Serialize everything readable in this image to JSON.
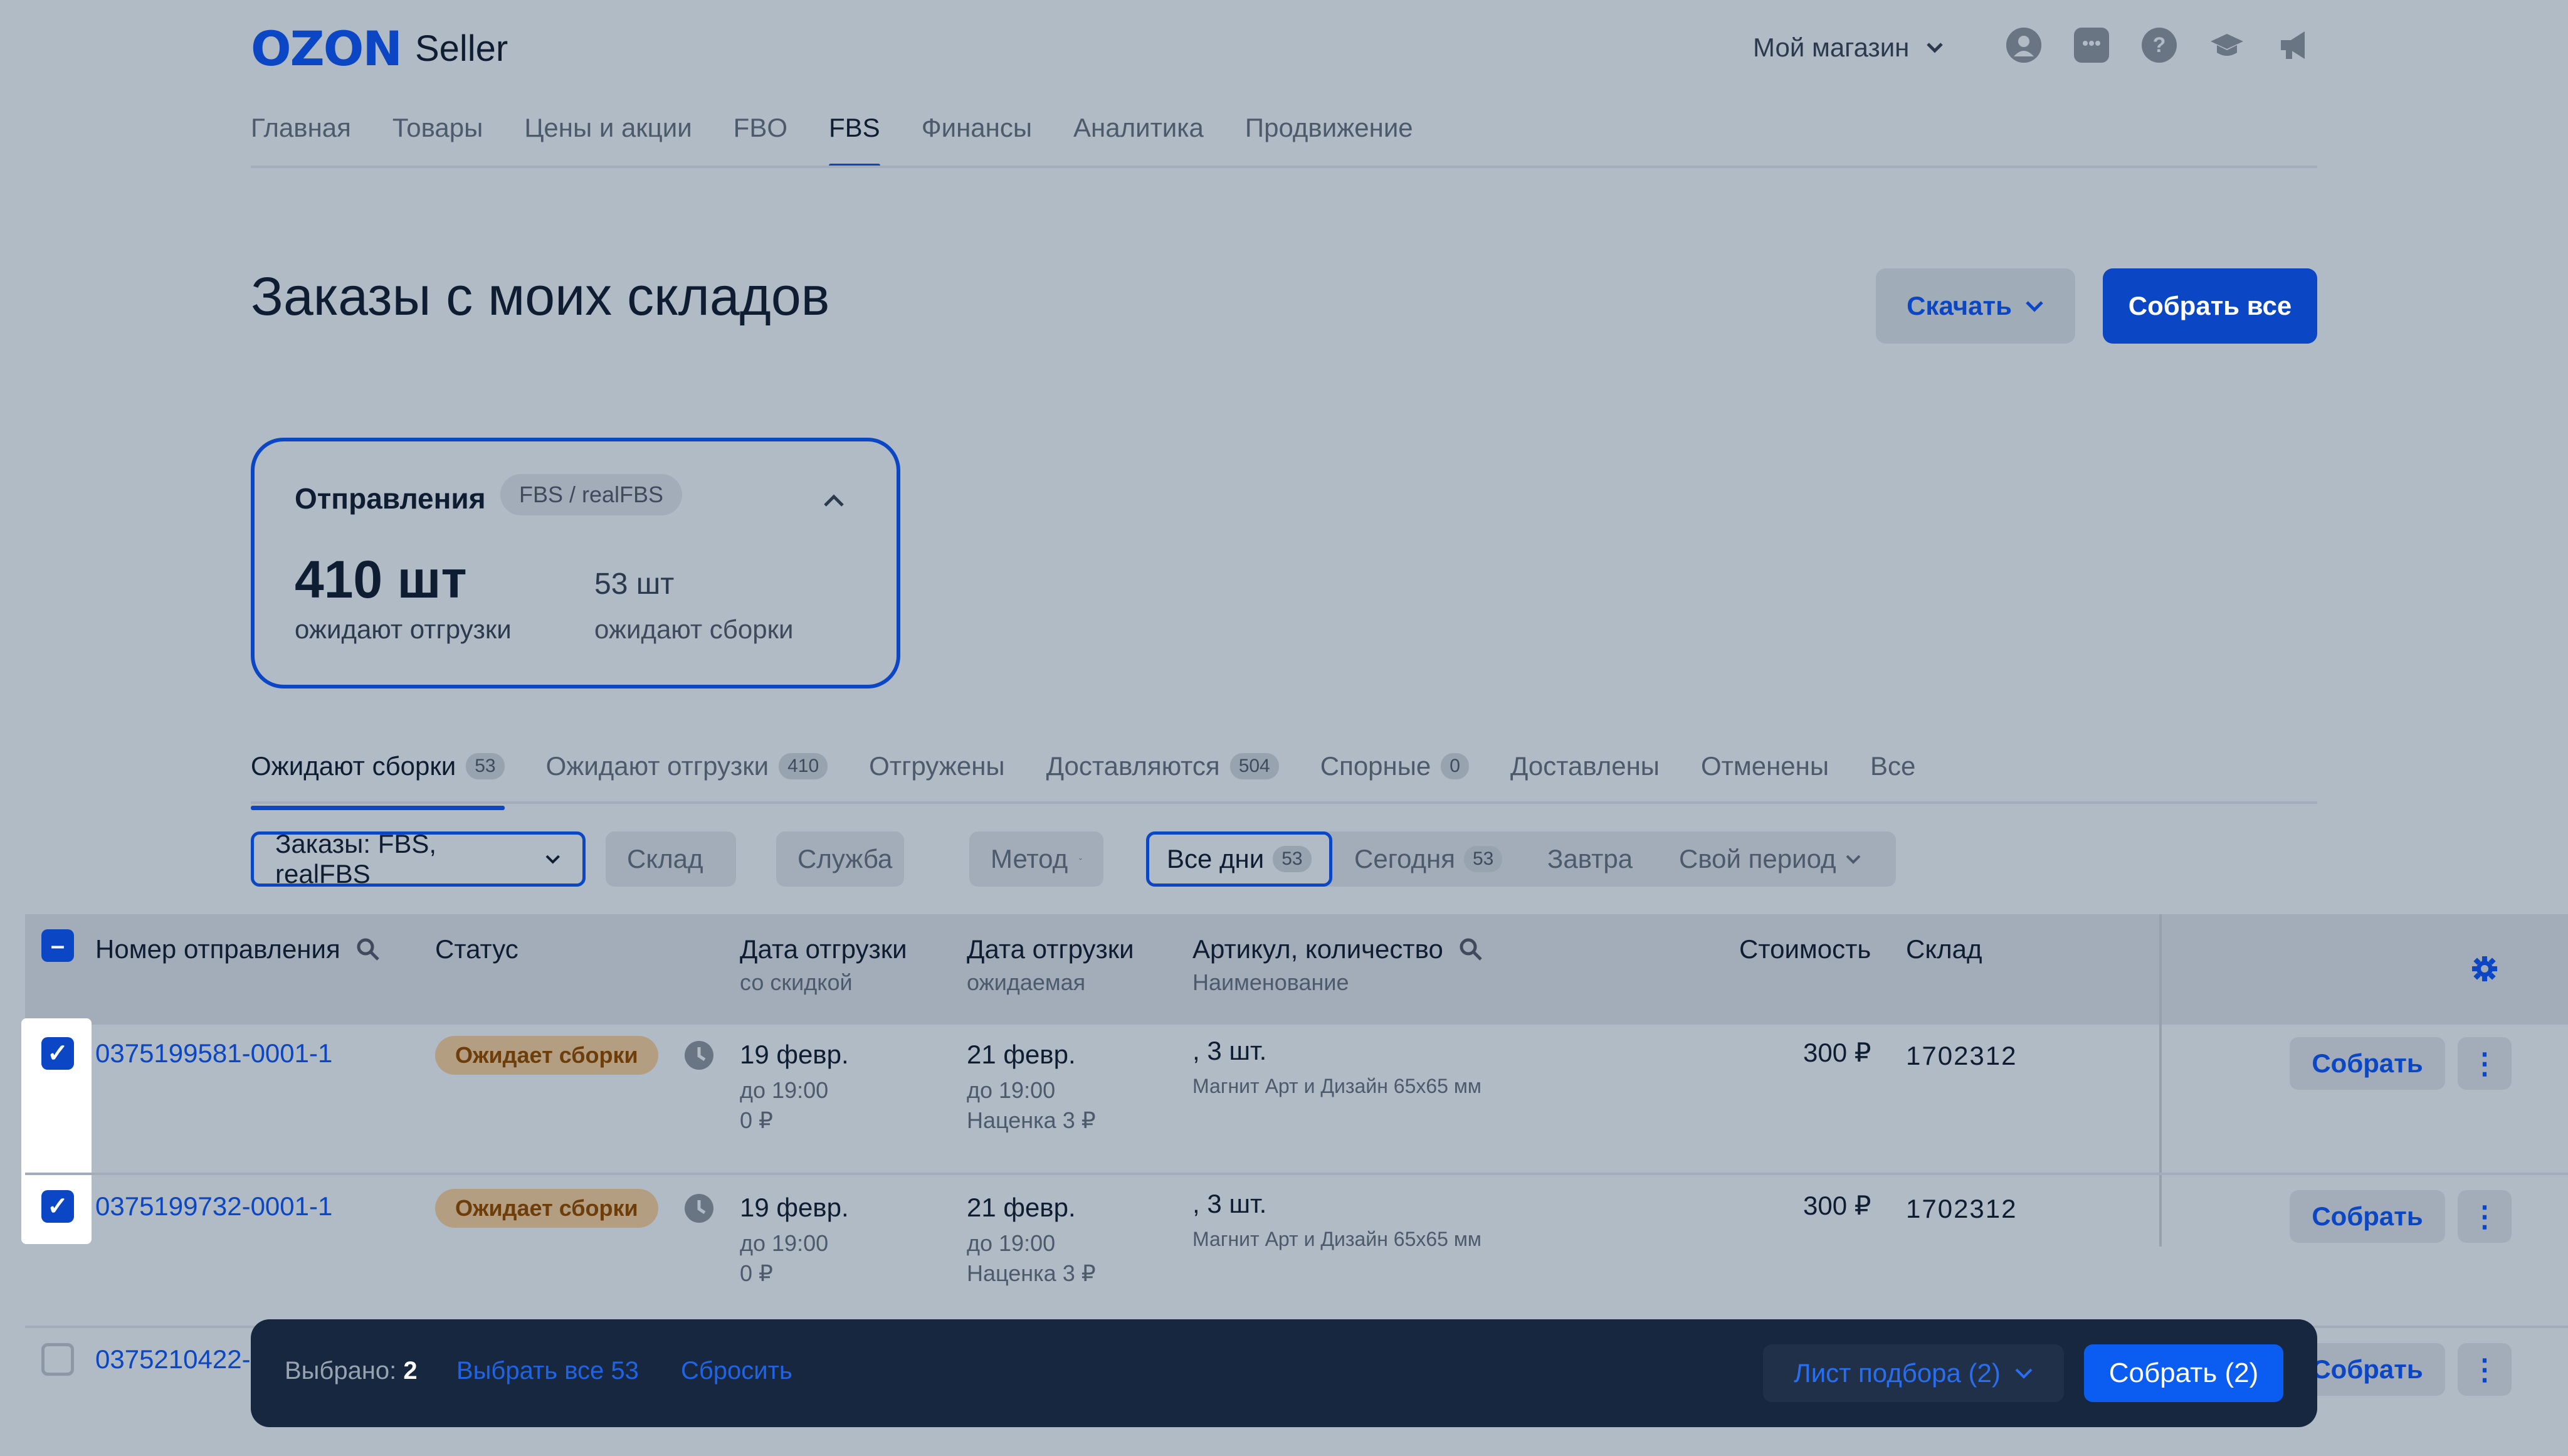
{
  "header": {
    "logo_brand": "OZON",
    "logo_product": "Seller",
    "store_selector": "Мой магазин",
    "icons": [
      "profile-icon",
      "chat-icon",
      "help-icon",
      "education-icon",
      "announcement-icon"
    ]
  },
  "nav": {
    "items": [
      "Главная",
      "Товары",
      "Цены и акции",
      "FBO",
      "FBS",
      "Финансы",
      "Аналитика",
      "Продвижение"
    ],
    "active": "FBS"
  },
  "page": {
    "title": "Заказы с моих складов",
    "download_label": "Скачать",
    "collect_all_label": "Собрать все"
  },
  "summary": {
    "title": "Отправления",
    "badge": "FBS / realFBS",
    "awaiting_shipment_count": "410 шт",
    "awaiting_shipment_label": "ожидают отгрузки",
    "awaiting_assembly_count": "53 шт",
    "awaiting_assembly_label": "ожидают сборки"
  },
  "tabs": [
    {
      "label": "Ожидают сборки",
      "count": "53",
      "active": true
    },
    {
      "label": "Ожидают отгрузки",
      "count": "410"
    },
    {
      "label": "Отгружены",
      "count": ""
    },
    {
      "label": "Доставляются",
      "count": "504"
    },
    {
      "label": "Спорные",
      "count": "0"
    },
    {
      "label": "Доставлены",
      "count": ""
    },
    {
      "label": "Отменены",
      "count": ""
    },
    {
      "label": "Все",
      "count": ""
    }
  ],
  "filters": {
    "orders": "Заказы: FBS, realFBS",
    "warehouse": "Склад",
    "service": "Служба",
    "method": "Метод",
    "all_days": "Все дни",
    "all_days_count": "53",
    "today": "Сегодня",
    "today_count": "53",
    "tomorrow": "Завтра",
    "custom_period": "Свой период"
  },
  "table": {
    "columns": {
      "shipment_number": "Номер отправления",
      "status": "Статус",
      "ship_date_discount": "Дата отгрузки",
      "ship_date_discount_sub": "со скидкой",
      "ship_date_expected": "Дата отгрузки",
      "ship_date_expected_sub": "ожидаемая",
      "sku_qty": "Артикул, количество",
      "sku_qty_sub": "Наименование",
      "cost": "Стоимость",
      "warehouse": "Склад"
    },
    "rows": [
      {
        "number": "0375199581-0001-1",
        "status": "Ожидает сборки",
        "date1": "19 февр.",
        "date1_time": "до 19:00",
        "date1_extra": "0 ₽",
        "date2": "21 февр.",
        "date2_time": "до 19:00",
        "date2_extra": "Наценка 3 ₽",
        "sku": ", 3 шт.",
        "product": "Магнит Арт и Дизайн 65х65 мм",
        "cost": "300 ₽",
        "warehouse": "1702312",
        "action": "Собрать",
        "checked": true
      },
      {
        "number": "0375199732-0001-1",
        "status": "Ожидает сборки",
        "date1": "19 февр.",
        "date1_time": "до 19:00",
        "date1_extra": "0 ₽",
        "date2": "21 февр.",
        "date2_time": "до 19:00",
        "date2_extra": "Наценка 3 ₽",
        "sku": ", 3 шт.",
        "product": "Магнит Арт и Дизайн 65х65 мм",
        "cost": "300 ₽",
        "warehouse": "1702312",
        "action": "Собрать",
        "checked": true
      },
      {
        "number": "0375210422-",
        "action": "Собрать",
        "checked": false
      }
    ]
  },
  "action_bar": {
    "selected_label": "Выбрано:",
    "selected_count": "2",
    "select_all": "Выбрать все 53",
    "reset": "Сбросить",
    "pick_list": "Лист подбора (2)",
    "collect": "Собрать (2)"
  }
}
